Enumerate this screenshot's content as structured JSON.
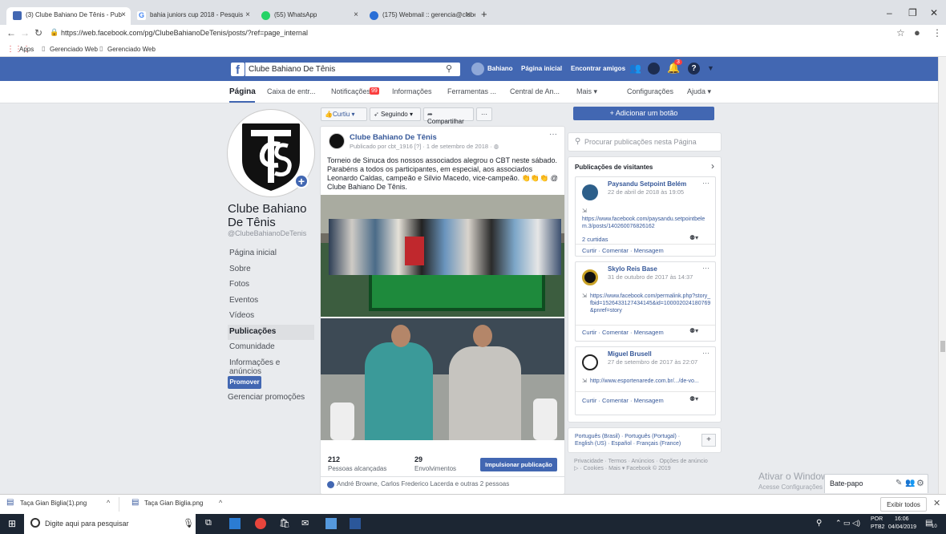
{
  "browser": {
    "tabs": [
      {
        "title": "(3) Clube Bahiano De Tênis - Pub",
        "fav_color": "#4267b2"
      },
      {
        "title": "bahia juniors cup 2018 - Pesquis",
        "fav_color": "#4285f4"
      },
      {
        "title": "(55) WhatsApp",
        "fav_color": "#25d366"
      },
      {
        "title": "(175) Webmail :: gerencia@clube",
        "fav_color": "#2a6fd6"
      }
    ],
    "new_tab": "+",
    "url": "https://web.facebook.com/pg/ClubeBahianoDeTenis/posts/?ref=page_internal",
    "bookmarks": [
      "Apps",
      "Gerenciado Web",
      "Gerenciado Web"
    ]
  },
  "fb_header": {
    "page_name": "Clube Bahiano De Tênis",
    "user": "Bahiano",
    "links": [
      "Página inicial",
      "Encontrar amigos"
    ],
    "notif_count": "3"
  },
  "subnav": {
    "items": [
      "Página",
      "Caixa de entr...",
      "Notificações",
      "Informações",
      "Ferramentas ...",
      "Central de An...",
      "Mais ▾",
      "Configurações",
      "Ajuda ▾"
    ],
    "notif_badge": "99"
  },
  "sidebar": {
    "name": "Clube Bahiano De Tênis",
    "handle": "@ClubeBahianoDeTenis",
    "items": [
      "Página inicial",
      "Sobre",
      "Fotos",
      "Eventos",
      "Vídeos",
      "Publicações",
      "Comunidade",
      "Informações e anúncios"
    ],
    "promote": "Promover",
    "manage": "Gerenciar promoções"
  },
  "actions": {
    "like": "Curtiu ▾",
    "follow": "Seguindo ▾",
    "share": "Compartilhar",
    "more": "···"
  },
  "post": {
    "author": "Clube Bahiano De Tênis",
    "meta": "Publicado por cbt_1916 [?] · 1 de setembro de 2018 · ",
    "text": "Torneio de Sinuca dos nossos associados alegrou o CBT neste sábado. Parabéns a todos os participantes, em especial, aos associados Leonardo Caldas, campeão e Silvio Macedo, vice-campeão. 👏👏👏 @ Clube Bahiano De Tênis.",
    "reach": "212",
    "reach_label": "Pessoas alcançadas",
    "engagement": "29",
    "engagement_label": "Envolvimentos",
    "boost": "Impulsionar publicação",
    "likes": "André Browne, Carlos Frederico Lacerda e outras 2 pessoas"
  },
  "right": {
    "add_button": "+ Adicionar um botão",
    "search_placeholder": "Procurar publicações nesta Página",
    "visitor_title": "Publicações de visitantes",
    "visitor_posts": [
      {
        "name": "Paysandu Setpoint Belém",
        "date": "22 de abril de 2018 às 19:05",
        "body": "https://www.facebook.com/paysandu.setpointbelem.3/posts/140260076826162",
        "likes": "2 curtidas",
        "actions": "Curtir · Comentar · Mensagem"
      },
      {
        "name": "Skylo Reis Base",
        "date": "31 de outubro de 2017 às 14:37",
        "body": "https://www.facebook.com/permalink.php?story_fbid=1526433127434145&id=100002024180769&pnref=story",
        "actions": "Curtir · Comentar · Mensagem"
      },
      {
        "name": "Miguel Brusell",
        "date": "27 de setembro de 2017 às 22:07",
        "body": "http://www.esportenarede.com.br/.../de-vo...",
        "actions": "Curtir · Comentar · Mensagem"
      }
    ],
    "languages": "Português (Brasil) · Português (Portugal) · English (US) · Español · Français (France)",
    "footer": "Privacidade · Termos · Anúncios · Opções de anúncio ▷ · Cookies · Mais ▾ Facebook © 2019"
  },
  "windows_watermark": {
    "line1": "Ativar o Windows",
    "line2": "Acesse Configurações para ativar o Windows."
  },
  "chat": {
    "label": "Bate-papo"
  },
  "downloads": {
    "files": [
      "Taça Gian Biglia(1).png",
      "Taça Gian Biglia.png"
    ],
    "show_all": "Exibir todos"
  },
  "taskbar": {
    "search": "Digite aqui para pesquisar",
    "lang": "POR",
    "lang2": "PTB2",
    "time": "16:06",
    "date": "04/04/2019",
    "notif": "10"
  }
}
